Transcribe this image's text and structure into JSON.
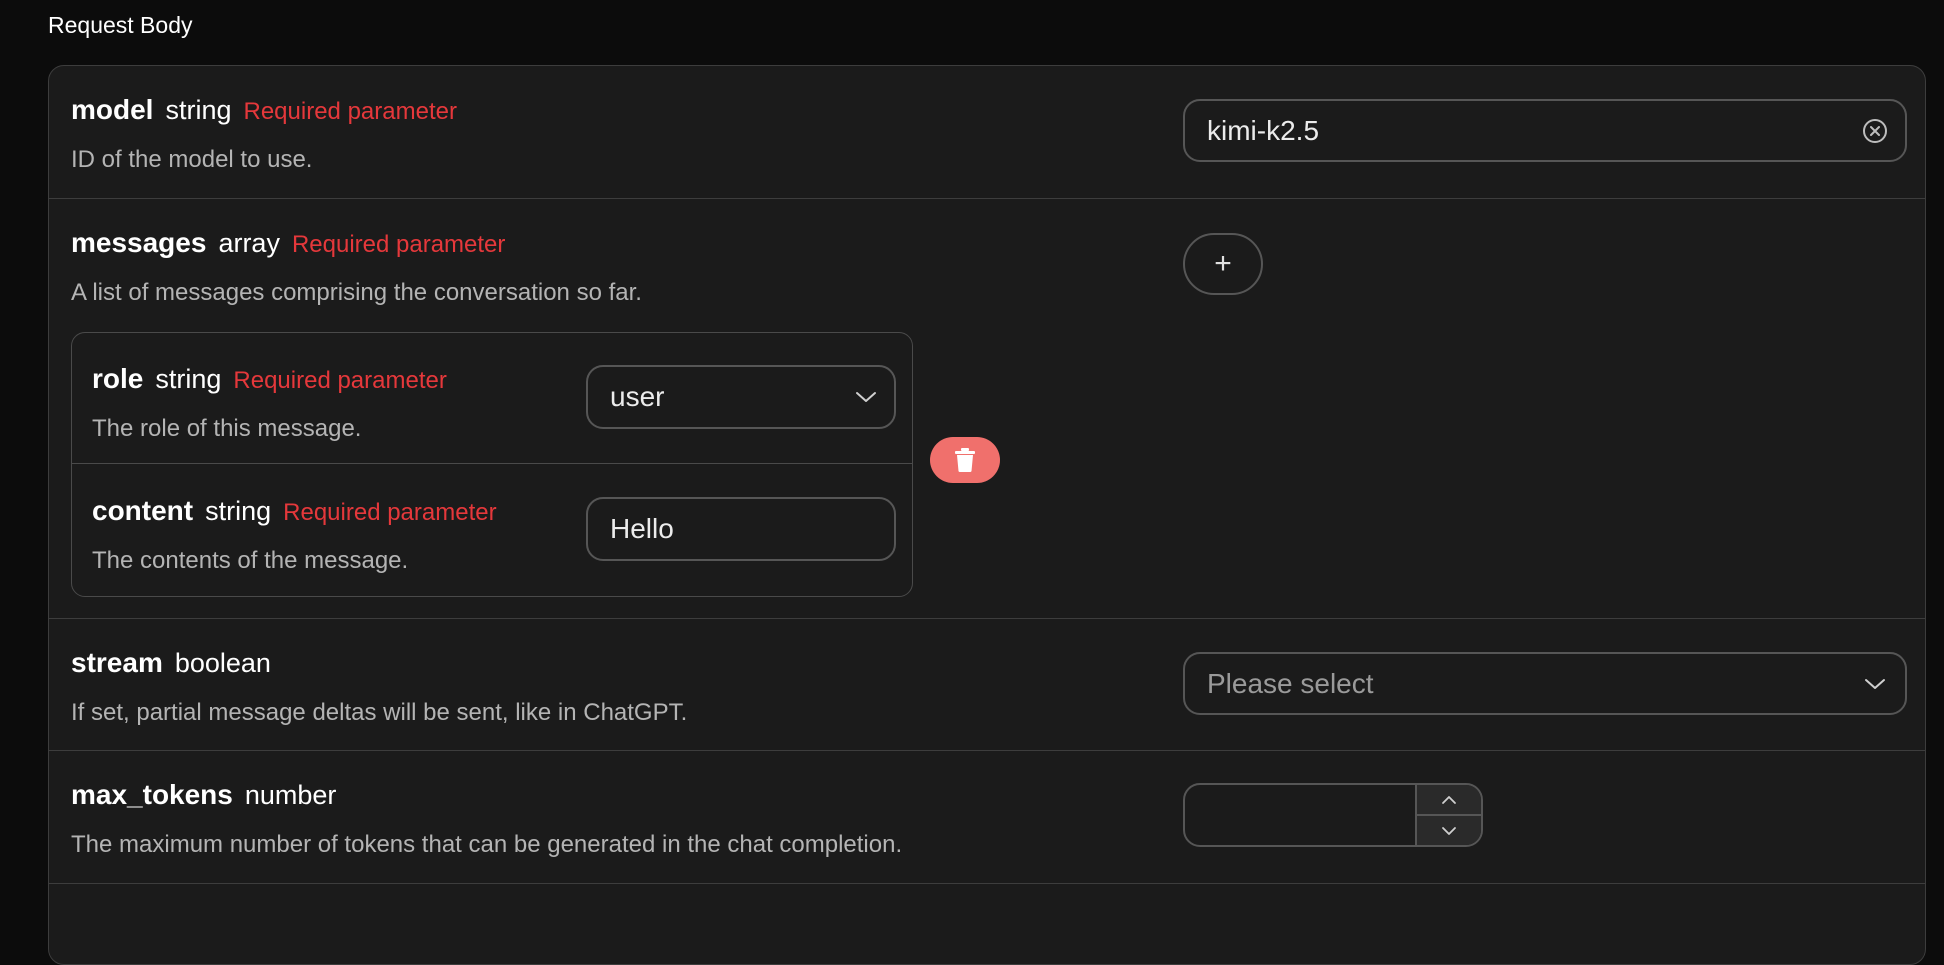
{
  "section": {
    "title": "Request Body"
  },
  "required_label": "Required parameter",
  "params": {
    "model": {
      "name": "model",
      "type": "string",
      "description": "ID of the model to use.",
      "value": "kimi-k2.5"
    },
    "messages": {
      "name": "messages",
      "type": "array",
      "description": "A list of messages comprising the conversation so far.",
      "add_label": "+",
      "item": {
        "role": {
          "name": "role",
          "type": "string",
          "description": "The role of this message.",
          "value": "user"
        },
        "content": {
          "name": "content",
          "type": "string",
          "description": "The contents of the message.",
          "value": "Hello"
        }
      }
    },
    "stream": {
      "name": "stream",
      "type": "boolean",
      "description": "If set, partial message deltas will be sent, like in ChatGPT.",
      "placeholder": "Please select"
    },
    "max_tokens": {
      "name": "max_tokens",
      "type": "number",
      "description": "The maximum number of tokens that can be generated in the chat completion.",
      "value": ""
    }
  },
  "icons": {
    "clear": "clear-circle-icon",
    "chevron": "chevron-down-icon",
    "trash": "trash-icon",
    "step_up": "chevron-up-icon",
    "step_down": "chevron-down-icon"
  },
  "colors": {
    "background": "#0c0c0c",
    "panel": "#1b1b1b",
    "border": "#3d3d3d",
    "required": "#e5383b",
    "danger": "#f0706c"
  }
}
